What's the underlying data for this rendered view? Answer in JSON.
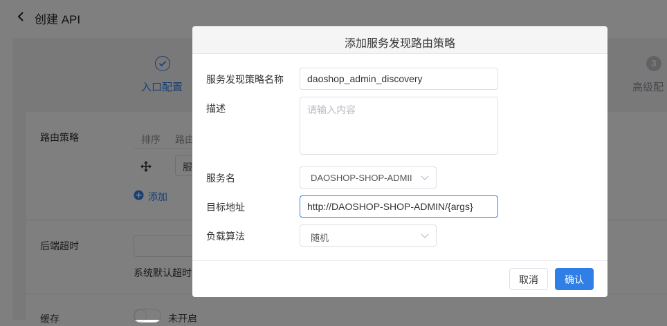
{
  "header": {
    "title": "创建 API"
  },
  "steps": [
    {
      "label": "入口配置"
    },
    {
      "number": "3",
      "label": "高级配"
    }
  ],
  "form": {
    "routing_label": "路由策略",
    "col_order": "排序",
    "col_route": "路由",
    "row_select_stub": "服",
    "add_label": "添加",
    "timeout_label": "后端超时",
    "timeout_hint": "系统默认超时",
    "cache_label": "缓存",
    "cache_state": "未开启"
  },
  "dialog": {
    "title": "添加服务发现路由策略",
    "fields": {
      "name_label": "服务发现策略名称",
      "name_value": "daoshop_admin_discovery",
      "desc_label": "描述",
      "desc_placeholder": "请输入内容",
      "service_label": "服务名",
      "service_value": "DAOSHOP-SHOP-ADMII",
      "target_label": "目标地址",
      "target_value": "http://DAOSHOP-SHOP-ADMIN/{args}",
      "lb_label": "负载算法",
      "lb_value": "随机"
    },
    "cancel_label": "取消",
    "confirm_label": "确认"
  },
  "colors": {
    "primary": "#2f7fe6",
    "overlay": "rgba(0,0,0,0.5)"
  }
}
